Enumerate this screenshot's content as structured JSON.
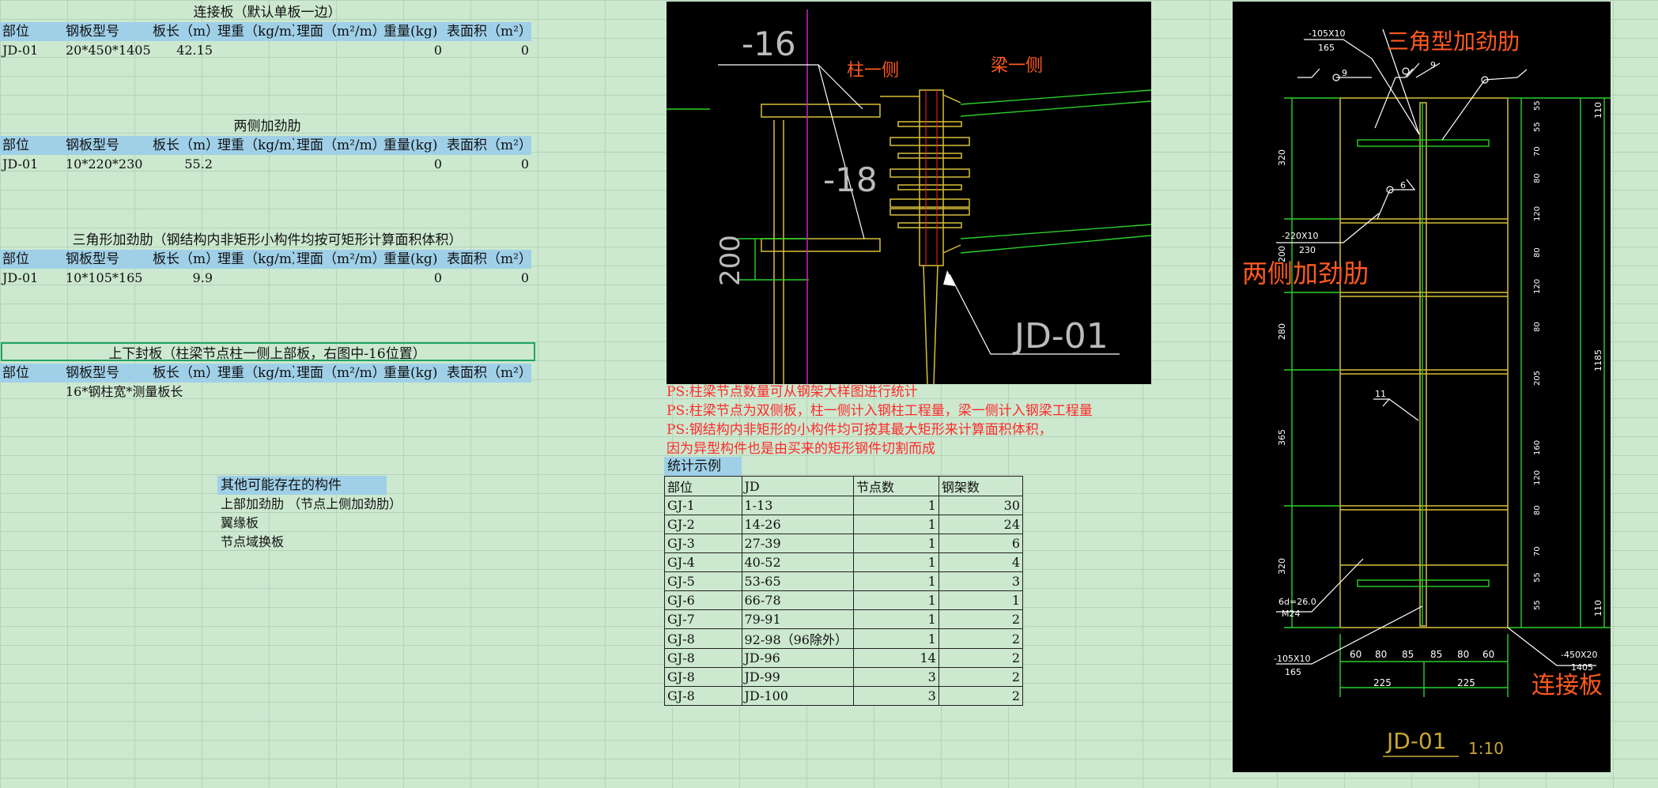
{
  "tables": [
    {
      "title": "连接板（默认单板一边）",
      "headers": [
        "部位",
        "钢板型号",
        "板长（m）",
        "理重（kg/m）",
        "理面（m²/m）",
        "重量(kg)",
        "表面积（m²）"
      ],
      "row": [
        "JD-01",
        "20*450*1405",
        "42.15",
        "",
        "",
        "0",
        "0"
      ]
    },
    {
      "title": "两侧加劲肋",
      "headers": [
        "部位",
        "钢板型号",
        "板长（m）",
        "理重（kg/m）",
        "理面（m²/m）",
        "重量(kg)",
        "表面积（m²）"
      ],
      "row": [
        "JD-01",
        "10*220*230",
        "55.2",
        "",
        "",
        "0",
        "0"
      ]
    },
    {
      "title": "三角形加劲肋（钢结构内非矩形小构件均按可矩形计算面积体积）",
      "headers": [
        "部位",
        "钢板型号",
        "板长（m）",
        "理重（kg/m）",
        "理面（m²/m）",
        "重量(kg)",
        "表面积（m²）"
      ],
      "row": [
        "JD-01",
        "10*105*165",
        "9.9",
        "",
        "",
        "0",
        "0"
      ]
    },
    {
      "title": "上下封板（柱梁节点柱一侧上部板，右图中-16位置）",
      "headers": [
        "部位",
        "钢板型号",
        "板长（m）",
        "理重（kg/m）",
        "理面（m²/m）",
        "重量(kg)",
        "表面积（m²）"
      ],
      "row": [
        "",
        "16*钢柱宽*测量板长",
        "",
        "",
        "",
        "",
        ""
      ]
    }
  ],
  "other": {
    "header": "其他可能存在的构件",
    "items": [
      "上部加劲肋 （节点上侧加劲肋）",
      "翼缘板",
      "节点域换板"
    ]
  },
  "notes": [
    "PS:柱梁节点数量可从钢架大样图进行统计",
    "PS:柱梁节点为双侧板，柱一侧计入钢柱工程量，梁一侧计入钢梁工程量",
    "PS:钢结构内非矩形的小构件均可按其最大矩形来计算面积体积，",
    "因为异型构件也是由买来的矩形钢件切割而成"
  ],
  "stats": {
    "caption": "统计示例",
    "headers": [
      "部位",
      "JD",
      "节点数",
      "钢架数"
    ],
    "rows": [
      [
        "GJ-1",
        "1-13",
        "1",
        "30"
      ],
      [
        "GJ-2",
        "14-26",
        "1",
        "24"
      ],
      [
        "GJ-3",
        "27-39",
        "1",
        "6"
      ],
      [
        "GJ-4",
        "40-52",
        "1",
        "4"
      ],
      [
        "GJ-5",
        "53-65",
        "1",
        "3"
      ],
      [
        "GJ-6",
        "66-78",
        "1",
        "1"
      ],
      [
        "GJ-7",
        "79-91",
        "1",
        "2"
      ],
      [
        "GJ-8",
        "92-98（96除外）",
        "1",
        "2"
      ],
      [
        "GJ-8",
        "JD-96",
        "14",
        "2"
      ],
      [
        "GJ-8",
        "JD-99",
        "3",
        "2"
      ],
      [
        "GJ-8",
        "JD-100",
        "3",
        "2"
      ]
    ]
  },
  "cad1": {
    "dim_top": "-16",
    "dim_mid": "-18",
    "dim_side": "200",
    "label_col": "柱一侧",
    "label_beam": "梁一侧",
    "node": "JD-01"
  },
  "cad2": {
    "label_triangle": "三角型加劲肋",
    "label_side": "两侧加劲肋",
    "label_plate": "连接板",
    "title": "JD-01",
    "scale": "1:10",
    "plate_top": "-105X10",
    "plate_top2": "165",
    "plate_mid": "-220X10",
    "plate_mid2": "230",
    "plate_bot": "-105X10",
    "plate_bot2": "165",
    "plate_right": "-450X20",
    "plate_right2": "1405",
    "hole": "6d=26.0",
    "hole2": "M24",
    "weld_a": "9",
    "weld_b": "9",
    "weld_c": "6",
    "weld_d": "11",
    "left_dims": [
      "320",
      "200",
      "280",
      "365",
      "320"
    ],
    "right_dims": [
      "55",
      "55",
      "70",
      "80",
      "120",
      "80",
      "120",
      "80",
      "205",
      "160",
      "120",
      "80",
      "70",
      "55",
      "55"
    ],
    "right_outer": [
      "110",
      "1185",
      "110"
    ],
    "bottom_dims": [
      "60",
      "80",
      "85",
      "85",
      "80",
      "60"
    ],
    "bottom_outer": [
      "225",
      "225"
    ]
  }
}
